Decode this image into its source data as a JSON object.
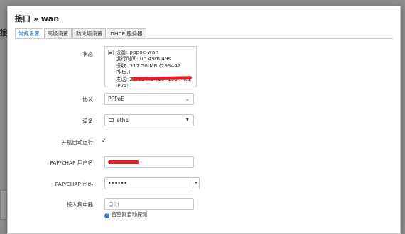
{
  "background": {
    "title": "接"
  },
  "dialog": {
    "title": "接口 » wan",
    "tabs": [
      {
        "label": "常规设置",
        "active": true
      },
      {
        "label": "高级设置",
        "active": false
      },
      {
        "label": "防火墙设置",
        "active": false
      },
      {
        "label": "DHCP 服务器",
        "active": false
      }
    ]
  },
  "form": {
    "status": {
      "label": "状态",
      "device": "设备: pppoe-wan",
      "uptime": "运行时间: 0h 49m 49s",
      "rx": "接收: 317.50 MB (293442 Pkts.)",
      "tx": "发送: 25.81 MB (197193 Pkts.)",
      "ipv4": "IPv4:"
    },
    "protocol": {
      "label": "协议",
      "value": "PPPoE",
      "icon": "chevron-down-icon"
    },
    "device": {
      "label": "设备",
      "value": "eth1",
      "icon": "caret-down-icon"
    },
    "autostart": {
      "label": "开机自动运行",
      "checked": true
    },
    "username": {
      "label": "PAP/CHAP 用户名",
      "value": "1"
    },
    "password": {
      "label": "PAP/CHAP 密码",
      "value": "••••••"
    },
    "concentrator": {
      "label": "接入集中器",
      "placeholder": "自动",
      "hint": "留空则自动探测"
    }
  },
  "colors": {
    "accent": "#1a6fba",
    "redaction": "#e31c25",
    "hint_icon": "#2f78c4"
  }
}
